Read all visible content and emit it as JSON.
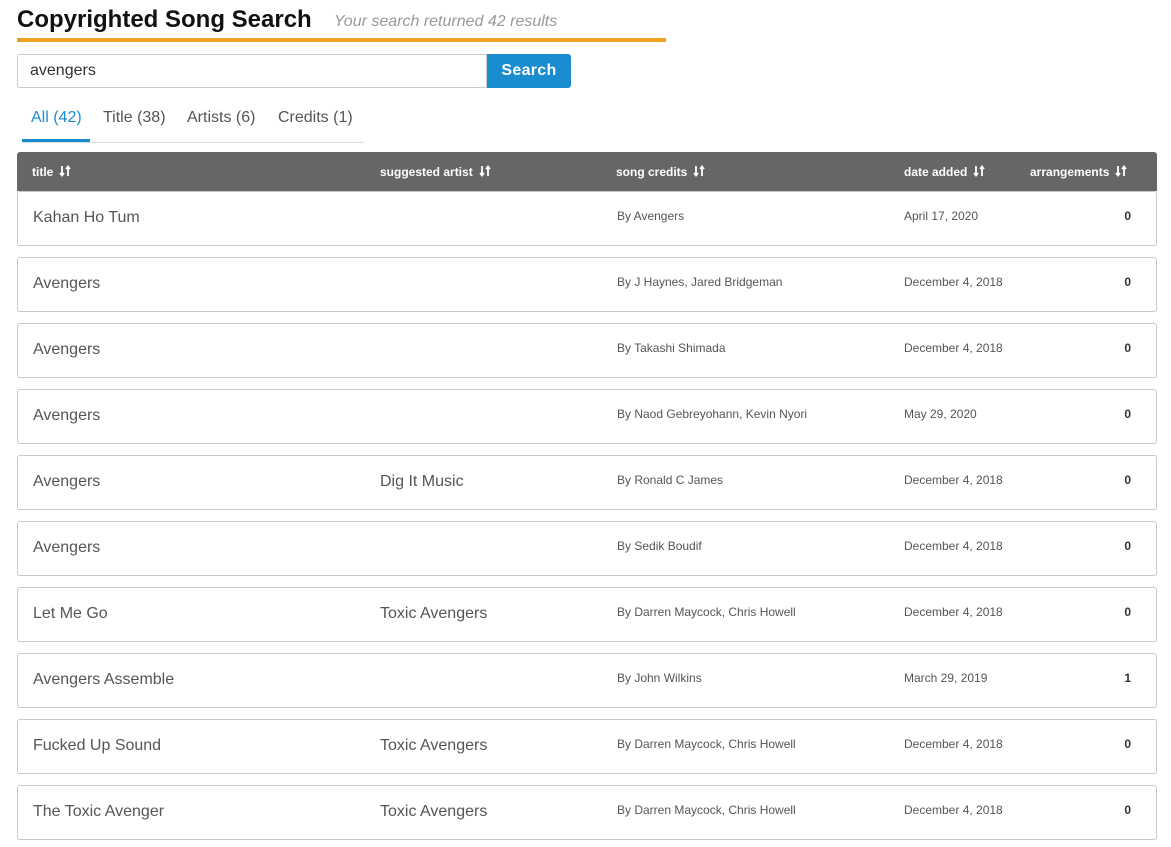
{
  "header": {
    "title": "Copyrighted Song Search",
    "results_text": "Your search returned 42 results",
    "accent_color": "#f0a020"
  },
  "search": {
    "value": "avengers",
    "button_label": "Search",
    "button_color": "#1a8dd0"
  },
  "tabs": [
    {
      "label": "All (42)",
      "active": true
    },
    {
      "label": "Title (38)",
      "active": false
    },
    {
      "label": "Artists (6)",
      "active": false
    },
    {
      "label": "Credits (1)",
      "active": false
    }
  ],
  "table": {
    "header_color": "#666666",
    "columns": [
      {
        "label": "title",
        "icon": "sort-icon"
      },
      {
        "label": "suggested artist",
        "icon": "sort-icon"
      },
      {
        "label": "song credits",
        "icon": "sort-icon"
      },
      {
        "label": "date added",
        "icon": "sort-icon"
      },
      {
        "label": "arrangements",
        "icon": "sort-icon"
      }
    ],
    "rows": [
      {
        "title": "Kahan Ho Tum",
        "artist": "",
        "credits": "By Avengers",
        "date": "April 17, 2020",
        "arrangements": "0"
      },
      {
        "title": "Avengers",
        "artist": "",
        "credits": "By J Haynes, Jared Bridgeman",
        "date": "December 4, 2018",
        "arrangements": "0"
      },
      {
        "title": "Avengers",
        "artist": "",
        "credits": "By Takashi Shimada",
        "date": "December 4, 2018",
        "arrangements": "0"
      },
      {
        "title": "Avengers",
        "artist": "",
        "credits": "By Naod Gebreyohann, Kevin Nyori",
        "date": "May 29, 2020",
        "arrangements": "0"
      },
      {
        "title": "Avengers",
        "artist": "Dig It Music",
        "credits": "By Ronald C James",
        "date": "December 4, 2018",
        "arrangements": "0"
      },
      {
        "title": "Avengers",
        "artist": "",
        "credits": "By Sedik Boudif",
        "date": "December 4, 2018",
        "arrangements": "0"
      },
      {
        "title": "Let Me Go",
        "artist": "Toxic Avengers",
        "credits": "By Darren Maycock, Chris Howell",
        "date": "December 4, 2018",
        "arrangements": "0"
      },
      {
        "title": "Avengers Assemble",
        "artist": "",
        "credits": "By John Wilkins",
        "date": "March 29, 2019",
        "arrangements": "1"
      },
      {
        "title": "Fucked Up Sound",
        "artist": "Toxic Avengers",
        "credits": "By Darren Maycock, Chris Howell",
        "date": "December 4, 2018",
        "arrangements": "0"
      },
      {
        "title": "The Toxic Avenger",
        "artist": "Toxic Avengers",
        "credits": "By Darren Maycock, Chris Howell",
        "date": "December 4, 2018",
        "arrangements": "0"
      }
    ]
  }
}
